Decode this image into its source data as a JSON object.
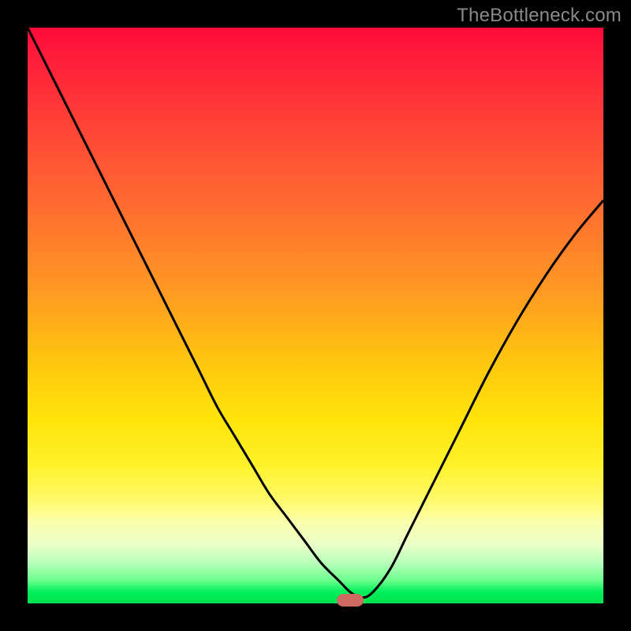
{
  "watermark": "TheBottleneck.com",
  "colors": {
    "curve_stroke": "#000000",
    "marker_fill": "#cf6a63",
    "frame_bg": "#000000"
  },
  "chart_data": {
    "type": "line",
    "title": "",
    "xlabel": "",
    "ylabel": "",
    "xlim": [
      0,
      100
    ],
    "ylim": [
      0,
      100
    ],
    "grid": false,
    "legend": false,
    "series": [
      {
        "name": "bottleneck-curve",
        "x": [
          0,
          3,
          6,
          9,
          12,
          15,
          18,
          21,
          24,
          27,
          30,
          33,
          36,
          39,
          42,
          45,
          48,
          51,
          54,
          56,
          58,
          60,
          63,
          66,
          70,
          75,
          80,
          85,
          90,
          95,
          100
        ],
        "y": [
          100,
          94,
          88,
          82,
          76,
          70,
          64,
          58,
          52,
          46,
          40,
          34,
          29,
          24,
          19,
          15,
          11,
          7,
          4,
          2,
          1,
          2,
          6,
          12,
          20,
          30,
          40,
          49,
          57,
          64,
          70
        ]
      }
    ],
    "marker": {
      "x": 56,
      "y": 0.5
    },
    "gradient_stops": [
      {
        "pos": 0,
        "color": "#ff0a3a"
      },
      {
        "pos": 50,
        "color": "#ffc60f"
      },
      {
        "pos": 85,
        "color": "#fbffb0"
      },
      {
        "pos": 100,
        "color": "#00e24e"
      }
    ]
  }
}
